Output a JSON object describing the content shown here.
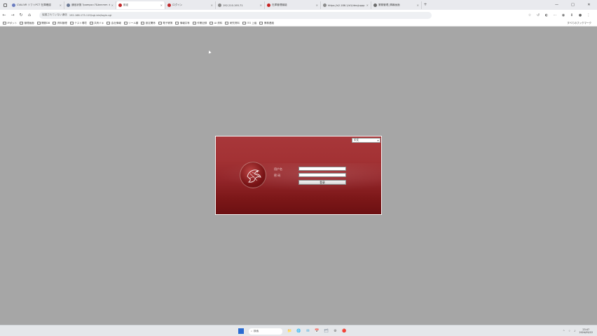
{
  "browser": {
    "tabs": [
      {
        "title": "CVA-IVR ソフトPCT 在庫確認",
        "color": "#6a7cc0",
        "active": false
      },
      {
        "title": "通信状態 ?pompo=?&bnnmm ＊",
        "color": "#6c7a96",
        "active": false
      },
      {
        "title": "設定",
        "color": "#c0282a",
        "active": true
      },
      {
        "title": "ログイン",
        "color": "#c0282a",
        "active": false
      },
      {
        "title": "192.210.195.71",
        "color": "#888888",
        "active": false
      },
      {
        "title": "在庫管理機能",
        "color": "#c62121",
        "active": false
      },
      {
        "title": "https://s2.186.1/d1/dev/pppp",
        "color": "#8a8a8a",
        "active": false
      },
      {
        "title": "業務管理_情報画面",
        "color": "#6b6b6b",
        "active": false
      }
    ],
    "new_tab": "+",
    "window_controls": {
      "min": "—",
      "max": "□",
      "close": "✕"
    },
    "address": {
      "security": "保護されていない通信",
      "url": "192.168.173.119/cgi-bin/login.cgi"
    },
    "nav": {
      "back": "←",
      "forward": "→",
      "reload": "↻",
      "home": "⌂"
    },
    "extensions": [
      "☆",
      "↺",
      "◐",
      "⋯",
      "◉",
      "⬇",
      "●",
      "⋮"
    ],
    "bookmarks": [
      "IPボット",
      "管理画面",
      "開発DB",
      "資料管理",
      "テスト環境",
      "共有ドキ",
      "会社情報",
      "ツール類",
      "設定関係",
      "電子帳簿",
      "情報共有",
      "作業記録",
      "AI 資料",
      "研究資料",
      "ITO 上級",
      "業務連絡"
    ],
    "all_bookmarks": "すべてのブックマーク"
  },
  "login": {
    "language": "中文",
    "username_label": "用户名",
    "password_label": "密  码",
    "submit_label": "登录",
    "accent": "#a33234"
  },
  "taskbar": {
    "search_placeholder": "検索",
    "apps": [
      "📁",
      "🌐",
      "✉",
      "📅",
      "🗂",
      "⚙",
      "🔴"
    ],
    "tray": {
      "chevron": "^",
      "time": "23:47",
      "date": "2024/05/22"
    }
  }
}
